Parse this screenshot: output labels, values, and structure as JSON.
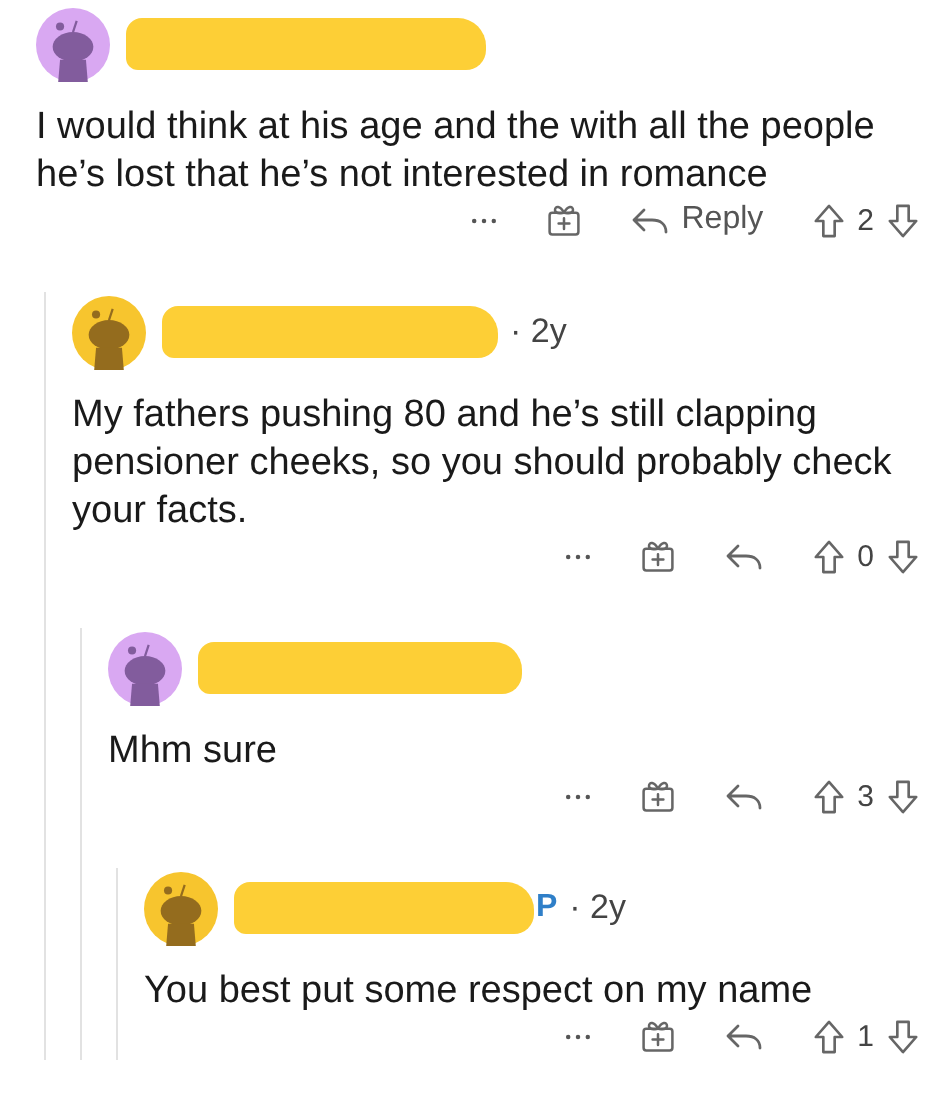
{
  "comments": [
    {
      "color": "#d9a8f2",
      "body": "I would think at his age and the with all the people he’s lost that he’s not interested in romance",
      "reply_label": "Reply",
      "score": "2",
      "children": [
        {
          "color": "#f7c52e",
          "age": "· 2y",
          "body": "My fathers pushing 80 and he’s still clapping pensioner cheeks, so you should probably check your facts.",
          "score": "0",
          "children": [
            {
              "color": "#d9a8f2",
              "body": "Mhm sure",
              "score": "3",
              "children": [
                {
                  "color": "#f7c52e",
                  "op_label": "P",
                  "age": "· 2y",
                  "body": "You best put some respect on my name",
                  "score": "1"
                }
              ]
            }
          ]
        }
      ]
    }
  ]
}
